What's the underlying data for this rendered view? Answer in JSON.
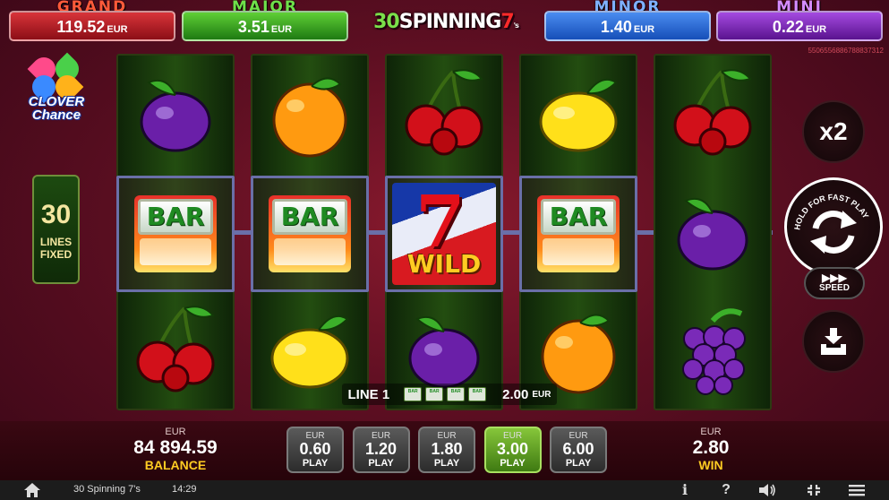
{
  "jackpots": {
    "grand": {
      "label": "GRAND",
      "value": "119.52",
      "currency": "EUR"
    },
    "major": {
      "label": "MAJOR",
      "value": "3.51",
      "currency": "EUR"
    },
    "minor": {
      "label": "MINOR",
      "value": "1.40",
      "currency": "EUR"
    },
    "mini": {
      "label": "MINI",
      "value": "0.22",
      "currency": "EUR"
    }
  },
  "logo": {
    "num": "30",
    "word": "SPINNING",
    "seven": "7",
    "suffix": "'s"
  },
  "serial": "5506556886788837312",
  "side": {
    "clover_line1": "CLOVER",
    "clover_line2": "Chance",
    "lines_count": "30",
    "lines_line1": "LINES",
    "lines_line2": "FIXED"
  },
  "reels": [
    [
      "plum",
      "bar",
      "cherry"
    ],
    [
      "orange",
      "bar",
      "lemon"
    ],
    [
      "cherry",
      "wild",
      "plum"
    ],
    [
      "lemon",
      "bar",
      "orange"
    ],
    [
      "cherry",
      "plum",
      "grapes"
    ]
  ],
  "symbols": {
    "bar_text": "BAR",
    "wild_text": "WILD",
    "seven": "7"
  },
  "controls": {
    "multiplier": "x2",
    "spin_hold": "HOLD FOR FAST PLAY",
    "speed_label": "SPEED"
  },
  "line_win": {
    "label": "LINE 1",
    "amount": "2.00",
    "currency": "EUR",
    "mini_bar": "BAR"
  },
  "balance": {
    "currency": "EUR",
    "value": "84 894.59",
    "label": "BALANCE"
  },
  "bets": [
    {
      "currency": "EUR",
      "value": "0.60",
      "label": "PLAY"
    },
    {
      "currency": "EUR",
      "value": "1.20",
      "label": "PLAY"
    },
    {
      "currency": "EUR",
      "value": "1.80",
      "label": "PLAY"
    },
    {
      "currency": "EUR",
      "value": "3.00",
      "label": "PLAY",
      "active": true
    },
    {
      "currency": "EUR",
      "value": "6.00",
      "label": "PLAY"
    }
  ],
  "win": {
    "currency": "EUR",
    "value": "2.80",
    "label": "WIN"
  },
  "statusbar": {
    "game_name": "30 Spinning 7's",
    "clock": "14:29",
    "info": "i",
    "help": "?"
  },
  "colors": {
    "reel_green": "#234d10",
    "payline": "#6a6fa8",
    "active_bet": "#86c63a",
    "win_gold": "#ffcc22"
  }
}
